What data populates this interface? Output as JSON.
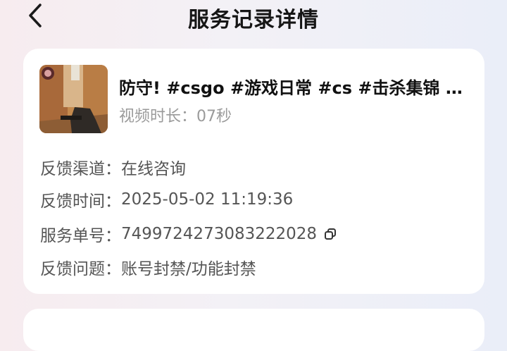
{
  "header": {
    "title": "服务记录详情"
  },
  "video": {
    "title": "防守! #csgo #游戏日常 #cs #击杀集锦 …",
    "duration_label": "视频时长：",
    "duration_value": "07秒"
  },
  "details": [
    {
      "label": "反馈渠道：",
      "value": "在线咨询"
    },
    {
      "label": "反馈时间：",
      "value": "2025-05-02 11:19:36"
    },
    {
      "label": "服务单号：",
      "value": "7499724273083222028"
    },
    {
      "label": "反馈问题：",
      "value": "账号封禁/功能封禁"
    }
  ],
  "icons": {
    "back": "chevron-left-icon",
    "copy": "copy-icon"
  }
}
